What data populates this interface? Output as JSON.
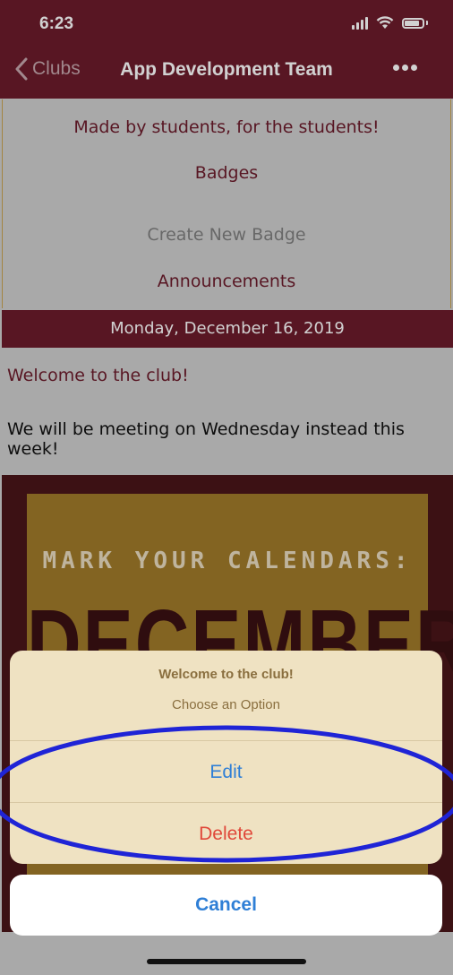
{
  "status_bar": {
    "time": "6:23"
  },
  "nav": {
    "back_label": "Clubs",
    "title": "App Development Team"
  },
  "club_info": {
    "tagline": "Made by students, for the students!",
    "badges_heading": "Badges",
    "create_badge": "Create New Badge",
    "announcements_heading": "Announcements"
  },
  "announcement": {
    "date": "Monday, December 16, 2019",
    "title": "Welcome to the club!",
    "body": "We will be meeting on Wednesday instead this week!",
    "image_text_1": "MARK YOUR CALENDARS:",
    "image_text_2": "DECEMBER"
  },
  "action_sheet": {
    "title": "Welcome to the club!",
    "message": "Choose an Option",
    "edit_label": "Edit",
    "delete_label": "Delete",
    "cancel_label": "Cancel"
  },
  "colors": {
    "brand": "#6c1c2b",
    "accent_blue": "#2f7fd6",
    "destructive": "#e0483a",
    "annotation": "#1f24d6"
  },
  "icons": [
    "chevron-left-icon",
    "more-icon",
    "signal-icon",
    "wifi-icon",
    "battery-icon"
  ]
}
